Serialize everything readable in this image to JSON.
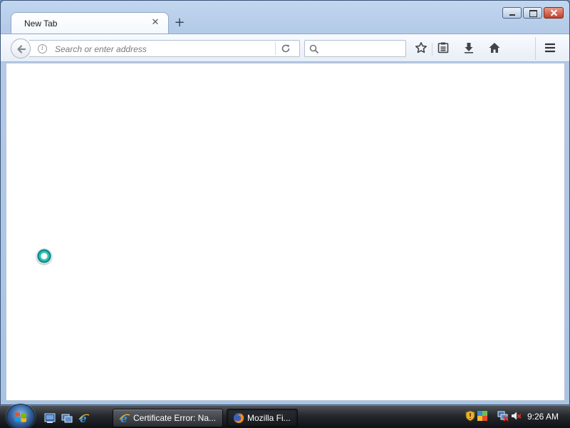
{
  "browser": {
    "tab": {
      "title": "New Tab",
      "close_icon": "close-icon"
    },
    "new_tab_icon": "plus-icon",
    "caption_buttons": [
      "minimize",
      "maximize",
      "close"
    ],
    "toolbar": {
      "url_placeholder": "Search or enter address",
      "url_value": "",
      "search_placeholder": "",
      "buttons": [
        "back-icon",
        "reload-icon",
        "bookmark-star-icon",
        "reading-list-icon",
        "download-icon",
        "home-icon",
        "menu-icon"
      ]
    }
  },
  "taskbar": {
    "start_icon": "windows-logo-icon",
    "quick_launch": [
      "show-desktop-icon",
      "switch-windows-icon",
      "internet-explorer-icon"
    ],
    "tasks": [
      {
        "label": "Certificate Error: Na...",
        "icon": "internet-explorer-icon",
        "active": false
      },
      {
        "label": "Mozilla Fi...",
        "icon": "firefox-icon",
        "active": true
      }
    ],
    "tray_icons": [
      "security-shield-icon",
      "network-status-icon",
      "network-disconnected-icon",
      "volume-muted-icon"
    ],
    "clock": "9:26 AM"
  },
  "colors": {
    "titlebar": "#b4cbe8",
    "taskbar": "#24282c",
    "busy_cursor": "#2cc3b2"
  }
}
